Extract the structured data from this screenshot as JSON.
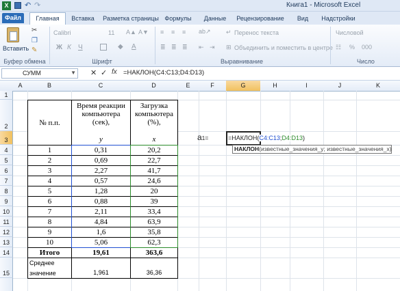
{
  "window": {
    "title": "Книга1 - Microsoft Excel"
  },
  "tabs": [
    "Файл",
    "Главная",
    "Вставка",
    "Разметка страницы",
    "Формулы",
    "Данные",
    "Рецензирование",
    "Вид",
    "Надстройки"
  ],
  "ribbon": {
    "paste_label": "Вставить",
    "font_name": "Calibri",
    "font_size": "11",
    "bold": "Ж",
    "italic": "К",
    "underline": "Ч",
    "wrap_text": "Перенос текста",
    "merge_center": "Объединить и поместить в центре",
    "number_format": "Числовой",
    "percent": "%",
    "thousands": "000",
    "groups": {
      "clipboard": "Буфер обмена",
      "font": "Шрифт",
      "alignment": "Выравнивание",
      "number": "Число"
    }
  },
  "formula_bar": {
    "name_box": "СУММ",
    "fx": "fx",
    "formula": "=НАКЛОН(C4:C13;D4:D13)"
  },
  "columns": [
    "A",
    "B",
    "C",
    "D",
    "E",
    "F",
    "G",
    "H",
    "I",
    "J",
    "K"
  ],
  "rows": [
    "1",
    "2",
    "3",
    "4",
    "5",
    "6",
    "7",
    "8",
    "9",
    "10",
    "11",
    "12",
    "13",
    "14",
    "15"
  ],
  "table": {
    "header_n": "№ п.п.",
    "header_c": "Время реакции компьютера (сек),",
    "header_d": "Загрузка компьютера (%),",
    "var_c": "y",
    "var_d": "x",
    "rows": [
      {
        "n": "1",
        "c": "0,31",
        "d": "20,2"
      },
      {
        "n": "2",
        "c": "0,69",
        "d": "22,7"
      },
      {
        "n": "3",
        "c": "2,27",
        "d": "41,7"
      },
      {
        "n": "4",
        "c": "0,57",
        "d": "24,6"
      },
      {
        "n": "5",
        "c": "1,28",
        "d": "20"
      },
      {
        "n": "6",
        "c": "0,88",
        "d": "39"
      },
      {
        "n": "7",
        "c": "2,11",
        "d": "33,4"
      },
      {
        "n": "8",
        "c": "4,84",
        "d": "63,9"
      },
      {
        "n": "9",
        "c": "1,6",
        "d": "35,8"
      },
      {
        "n": "10",
        "c": "5,06",
        "d": "62,3"
      }
    ],
    "total_label": "Итого",
    "total_c": "19,61",
    "total_d": "363,6",
    "avg_label": "Среднее значение",
    "avg_c": "1,961",
    "avg_d": "36,36"
  },
  "editing": {
    "label_a": "а",
    "label_sub": "1",
    "label_eq": "=",
    "func": "=НАКЛОН(",
    "ref1": "C4:C13",
    "sep": ";",
    "ref2": "D4:D13",
    "close": ")",
    "tooltip_func": "НАКЛОН",
    "tooltip_args": "(известные_значения_y; известные_значения_x)"
  },
  "colors": {
    "ref1": "#1f4fd1",
    "ref2": "#2a8a2a",
    "file_tab": "#2b6cb8"
  }
}
